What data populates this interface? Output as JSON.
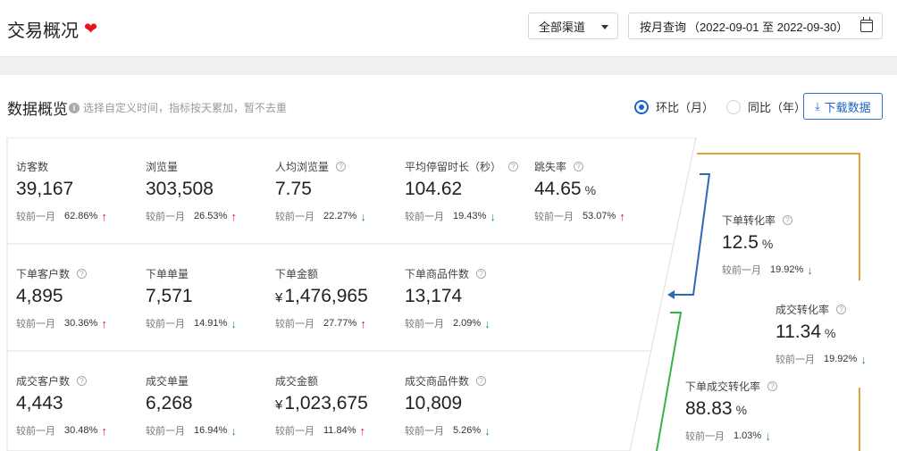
{
  "header": {
    "title": "交易概况",
    "channel_select": "全部渠道",
    "date_label": "按月查询",
    "date_range": "（2022-09-01 至 2022-09-30）"
  },
  "overview": {
    "title": "数据概览",
    "hint": "选择自定义时间，指标按天累加，暂不去重",
    "radio_mom": "环比（月）",
    "radio_yoy": "同比（年）",
    "download": "下载数据",
    "compare_label": "较前一月"
  },
  "rows": [
    [
      {
        "label": "访客数",
        "help": false,
        "value": "39,167",
        "pct": "62.86%",
        "trend": "up"
      },
      {
        "label": "浏览量",
        "help": false,
        "value": "303,508",
        "pct": "26.53%",
        "trend": "up"
      },
      {
        "label": "人均浏览量",
        "help": true,
        "value": "7.75",
        "pct": "22.27%",
        "trend": "down"
      },
      {
        "label": "平均停留时长（秒）",
        "help": true,
        "value": "104.62",
        "pct": "19.43%",
        "trend": "down"
      },
      {
        "label": "跳失率",
        "help": true,
        "value": "44.65",
        "unit": "%",
        "pct": "53.07%",
        "trend": "up"
      }
    ],
    [
      {
        "label": "下单客户数",
        "help": true,
        "value": "4,895",
        "pct": "30.36%",
        "trend": "up"
      },
      {
        "label": "下单单量",
        "help": false,
        "value": "7,571",
        "pct": "14.91%",
        "trend": "down"
      },
      {
        "label": "下单金额",
        "help": false,
        "value": "1,476,965",
        "currency": "¥",
        "pct": "27.77%",
        "trend": "up"
      },
      {
        "label": "下单商品件数",
        "help": true,
        "value": "13,174",
        "pct": "2.09%",
        "trend": "down"
      }
    ],
    [
      {
        "label": "成交客户数",
        "help": true,
        "value": "4,443",
        "pct": "30.48%",
        "trend": "up"
      },
      {
        "label": "成交单量",
        "help": false,
        "value": "6,268",
        "pct": "16.94%",
        "trend": "down"
      },
      {
        "label": "成交金额",
        "help": false,
        "value": "1,023,675",
        "currency": "¥",
        "pct": "11.84%",
        "trend": "up"
      },
      {
        "label": "成交商品件数",
        "help": true,
        "value": "10,809",
        "pct": "5.26%",
        "trend": "down"
      }
    ]
  ],
  "funnel": [
    {
      "label": "下单转化率",
      "value": "12.5",
      "unit": "%",
      "pct": "19.92%",
      "trend": "down"
    },
    {
      "label": "成交转化率",
      "value": "11.34",
      "unit": "%",
      "pct": "19.92%",
      "trend": "down"
    },
    {
      "label": "下单成交转化率",
      "value": "88.83",
      "unit": "%",
      "pct": "1.03%",
      "trend": "down"
    }
  ],
  "colors": {
    "accent": "#1e62c8",
    "up": "#e4141b",
    "down": "#2a9d3a",
    "funnel_orange": "#e3a238",
    "funnel_blue": "#2b68b8",
    "funnel_green": "#35b34a"
  }
}
